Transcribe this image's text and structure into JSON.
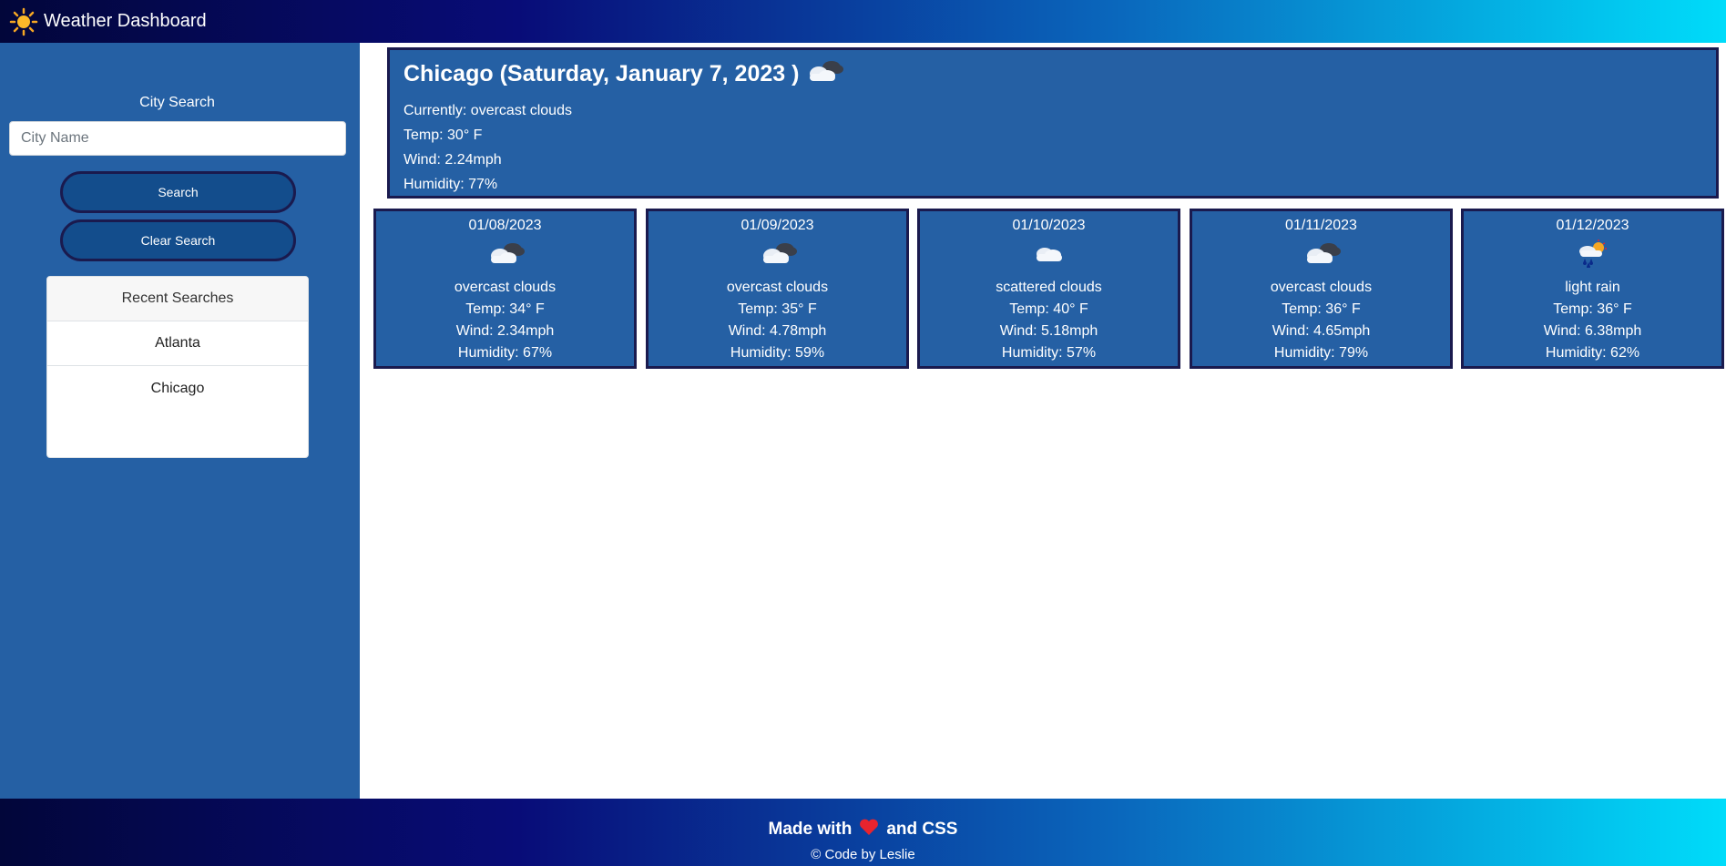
{
  "header": {
    "title": "Weather Dashboard",
    "icon": "sun-icon"
  },
  "sidebar": {
    "search_label": "City Search",
    "input_placeholder": "City Name",
    "input_value": "",
    "search_button": "Search",
    "clear_button": "Clear Search",
    "recent_header": "Recent Searches",
    "recent_items": [
      "Atlanta",
      "Chicago"
    ]
  },
  "current": {
    "title": "Chicago (Saturday, January 7, 2023 )",
    "icon": "overcast-cloud-icon",
    "currently": "Currently: overcast clouds",
    "temp": "Temp: 30° F",
    "wind": "Wind: 2.24mph",
    "humidity": "Humidity: 77%"
  },
  "forecast": [
    {
      "date": "01/08/2023",
      "icon": "overcast-cloud-icon",
      "desc": "overcast clouds",
      "temp": "Temp: 34° F",
      "wind": "Wind: 2.34mph",
      "humidity": "Humidity: 67%"
    },
    {
      "date": "01/09/2023",
      "icon": "overcast-cloud-icon",
      "desc": "overcast clouds",
      "temp": "Temp: 35° F",
      "wind": "Wind: 4.78mph",
      "humidity": "Humidity: 59%"
    },
    {
      "date": "01/10/2023",
      "icon": "scattered-cloud-icon",
      "desc": "scattered clouds",
      "temp": "Temp: 40° F",
      "wind": "Wind: 5.18mph",
      "humidity": "Humidity: 57%"
    },
    {
      "date": "01/11/2023",
      "icon": "overcast-cloud-icon",
      "desc": "overcast clouds",
      "temp": "Temp: 36° F",
      "wind": "Wind: 4.65mph",
      "humidity": "Humidity: 79%"
    },
    {
      "date": "01/12/2023",
      "icon": "light-rain-icon",
      "desc": "light rain",
      "temp": "Temp: 36° F",
      "wind": "Wind: 6.38mph",
      "humidity": "Humidity: 62%"
    }
  ],
  "footer": {
    "made_prefix": "Made with",
    "made_suffix": "and CSS",
    "credit": "© Code by Leslie",
    "heart_color": "#e8242e"
  },
  "colors": {
    "panel": "#2560a4",
    "border": "#1a1a4e",
    "button": "#134d8c"
  }
}
